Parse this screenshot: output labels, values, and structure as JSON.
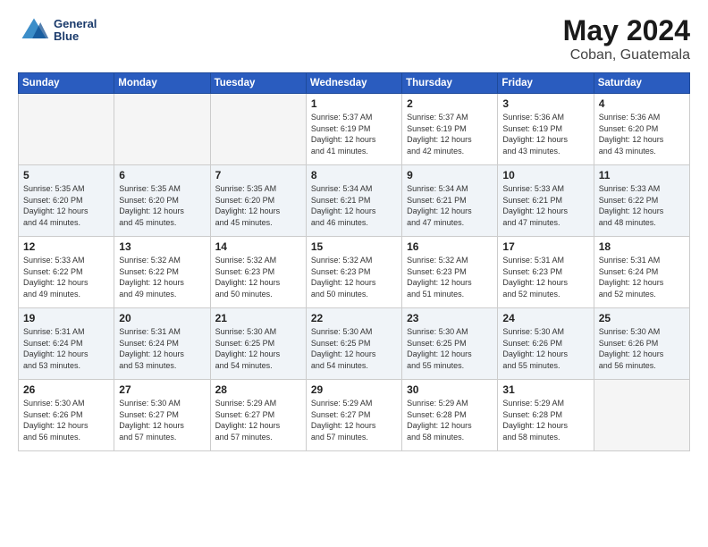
{
  "logo": {
    "line1": "General",
    "line2": "Blue"
  },
  "title": {
    "month_year": "May 2024",
    "location": "Coban, Guatemala"
  },
  "days_of_week": [
    "Sunday",
    "Monday",
    "Tuesday",
    "Wednesday",
    "Thursday",
    "Friday",
    "Saturday"
  ],
  "weeks": [
    [
      {
        "day": "",
        "info": ""
      },
      {
        "day": "",
        "info": ""
      },
      {
        "day": "",
        "info": ""
      },
      {
        "day": "1",
        "info": "Sunrise: 5:37 AM\nSunset: 6:19 PM\nDaylight: 12 hours\nand 41 minutes."
      },
      {
        "day": "2",
        "info": "Sunrise: 5:37 AM\nSunset: 6:19 PM\nDaylight: 12 hours\nand 42 minutes."
      },
      {
        "day": "3",
        "info": "Sunrise: 5:36 AM\nSunset: 6:19 PM\nDaylight: 12 hours\nand 43 minutes."
      },
      {
        "day": "4",
        "info": "Sunrise: 5:36 AM\nSunset: 6:20 PM\nDaylight: 12 hours\nand 43 minutes."
      }
    ],
    [
      {
        "day": "5",
        "info": "Sunrise: 5:35 AM\nSunset: 6:20 PM\nDaylight: 12 hours\nand 44 minutes."
      },
      {
        "day": "6",
        "info": "Sunrise: 5:35 AM\nSunset: 6:20 PM\nDaylight: 12 hours\nand 45 minutes."
      },
      {
        "day": "7",
        "info": "Sunrise: 5:35 AM\nSunset: 6:20 PM\nDaylight: 12 hours\nand 45 minutes."
      },
      {
        "day": "8",
        "info": "Sunrise: 5:34 AM\nSunset: 6:21 PM\nDaylight: 12 hours\nand 46 minutes."
      },
      {
        "day": "9",
        "info": "Sunrise: 5:34 AM\nSunset: 6:21 PM\nDaylight: 12 hours\nand 47 minutes."
      },
      {
        "day": "10",
        "info": "Sunrise: 5:33 AM\nSunset: 6:21 PM\nDaylight: 12 hours\nand 47 minutes."
      },
      {
        "day": "11",
        "info": "Sunrise: 5:33 AM\nSunset: 6:22 PM\nDaylight: 12 hours\nand 48 minutes."
      }
    ],
    [
      {
        "day": "12",
        "info": "Sunrise: 5:33 AM\nSunset: 6:22 PM\nDaylight: 12 hours\nand 49 minutes."
      },
      {
        "day": "13",
        "info": "Sunrise: 5:32 AM\nSunset: 6:22 PM\nDaylight: 12 hours\nand 49 minutes."
      },
      {
        "day": "14",
        "info": "Sunrise: 5:32 AM\nSunset: 6:23 PM\nDaylight: 12 hours\nand 50 minutes."
      },
      {
        "day": "15",
        "info": "Sunrise: 5:32 AM\nSunset: 6:23 PM\nDaylight: 12 hours\nand 50 minutes."
      },
      {
        "day": "16",
        "info": "Sunrise: 5:32 AM\nSunset: 6:23 PM\nDaylight: 12 hours\nand 51 minutes."
      },
      {
        "day": "17",
        "info": "Sunrise: 5:31 AM\nSunset: 6:23 PM\nDaylight: 12 hours\nand 52 minutes."
      },
      {
        "day": "18",
        "info": "Sunrise: 5:31 AM\nSunset: 6:24 PM\nDaylight: 12 hours\nand 52 minutes."
      }
    ],
    [
      {
        "day": "19",
        "info": "Sunrise: 5:31 AM\nSunset: 6:24 PM\nDaylight: 12 hours\nand 53 minutes."
      },
      {
        "day": "20",
        "info": "Sunrise: 5:31 AM\nSunset: 6:24 PM\nDaylight: 12 hours\nand 53 minutes."
      },
      {
        "day": "21",
        "info": "Sunrise: 5:30 AM\nSunset: 6:25 PM\nDaylight: 12 hours\nand 54 minutes."
      },
      {
        "day": "22",
        "info": "Sunrise: 5:30 AM\nSunset: 6:25 PM\nDaylight: 12 hours\nand 54 minutes."
      },
      {
        "day": "23",
        "info": "Sunrise: 5:30 AM\nSunset: 6:25 PM\nDaylight: 12 hours\nand 55 minutes."
      },
      {
        "day": "24",
        "info": "Sunrise: 5:30 AM\nSunset: 6:26 PM\nDaylight: 12 hours\nand 55 minutes."
      },
      {
        "day": "25",
        "info": "Sunrise: 5:30 AM\nSunset: 6:26 PM\nDaylight: 12 hours\nand 56 minutes."
      }
    ],
    [
      {
        "day": "26",
        "info": "Sunrise: 5:30 AM\nSunset: 6:26 PM\nDaylight: 12 hours\nand 56 minutes."
      },
      {
        "day": "27",
        "info": "Sunrise: 5:30 AM\nSunset: 6:27 PM\nDaylight: 12 hours\nand 57 minutes."
      },
      {
        "day": "28",
        "info": "Sunrise: 5:29 AM\nSunset: 6:27 PM\nDaylight: 12 hours\nand 57 minutes."
      },
      {
        "day": "29",
        "info": "Sunrise: 5:29 AM\nSunset: 6:27 PM\nDaylight: 12 hours\nand 57 minutes."
      },
      {
        "day": "30",
        "info": "Sunrise: 5:29 AM\nSunset: 6:28 PM\nDaylight: 12 hours\nand 58 minutes."
      },
      {
        "day": "31",
        "info": "Sunrise: 5:29 AM\nSunset: 6:28 PM\nDaylight: 12 hours\nand 58 minutes."
      },
      {
        "day": "",
        "info": ""
      }
    ]
  ]
}
